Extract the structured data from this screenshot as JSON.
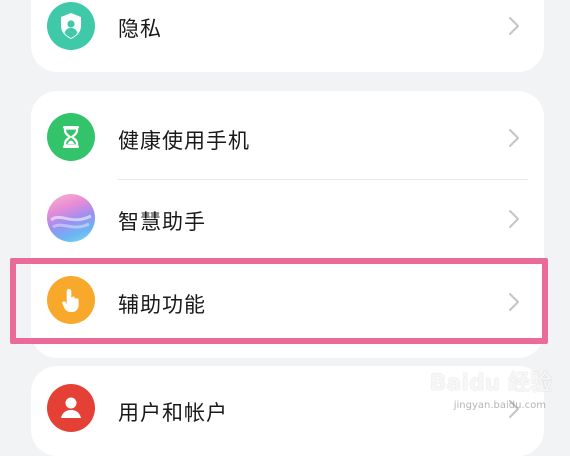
{
  "settings_items": {
    "privacy": {
      "label": "隐私",
      "icon": "shield-person-icon",
      "color": "#3fc9a8"
    },
    "digital_balance": {
      "label": "健康使用手机",
      "icon": "hourglass-icon",
      "color": "#33c46b"
    },
    "assistant": {
      "label": "智慧助手",
      "icon": "gradient-orb-icon"
    },
    "accessibility": {
      "label": "辅助功能",
      "icon": "hand-pointer-icon",
      "color": "#f8a92b"
    },
    "accounts": {
      "label": "用户和帐户",
      "icon": "person-icon",
      "color": "#e54036"
    }
  },
  "highlight_color": "#ea6b97",
  "watermark": {
    "brand": "Baidu 经验",
    "url": "jingyan.baidu.com"
  }
}
